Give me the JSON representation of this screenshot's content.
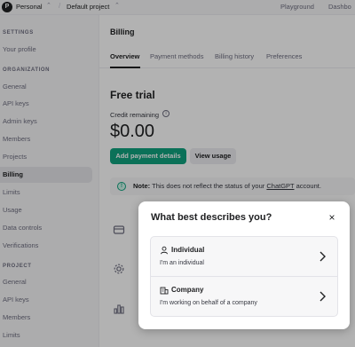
{
  "topbar": {
    "avatar_letter": "P",
    "org_name": "Personal",
    "project_name": "Default project",
    "nav_playground": "Playground",
    "nav_dashboard": "Dashbo"
  },
  "sidebar": {
    "settings_heading": "SETTINGS",
    "settings_items": [
      "Your profile"
    ],
    "org_heading": "ORGANIZATION",
    "org_items": [
      "General",
      "API keys",
      "Admin keys",
      "Members",
      "Projects",
      "Billing",
      "Limits",
      "Usage",
      "Data controls",
      "Verifications"
    ],
    "active_item": "Billing",
    "project_heading": "PROJECT",
    "project_items": [
      "General",
      "API keys",
      "Members",
      "Limits"
    ]
  },
  "billing": {
    "page_title": "Billing",
    "tabs": [
      "Overview",
      "Payment methods",
      "Billing history",
      "Preferences"
    ],
    "active_tab": "Overview",
    "section_title": "Free trial",
    "credit_label": "Credit remaining",
    "balance": "$0.00",
    "add_payment_label": "Add payment details",
    "view_usage_label": "View usage",
    "note_label": "Note:",
    "note_text": "This does not reflect the status of your",
    "note_link": "ChatGPT",
    "note_suffix": "account."
  },
  "modal": {
    "title": "What best describes you?",
    "close_glyph": "×",
    "options": [
      {
        "title": "Individual",
        "description": "I'm an individual",
        "icon": "person-icon"
      },
      {
        "title": "Company",
        "description": "I'm working on behalf of a company",
        "icon": "building-icon"
      }
    ]
  },
  "colors": {
    "accent": "#10a37f",
    "overlay": "rgba(0,0,0,0.30)"
  }
}
